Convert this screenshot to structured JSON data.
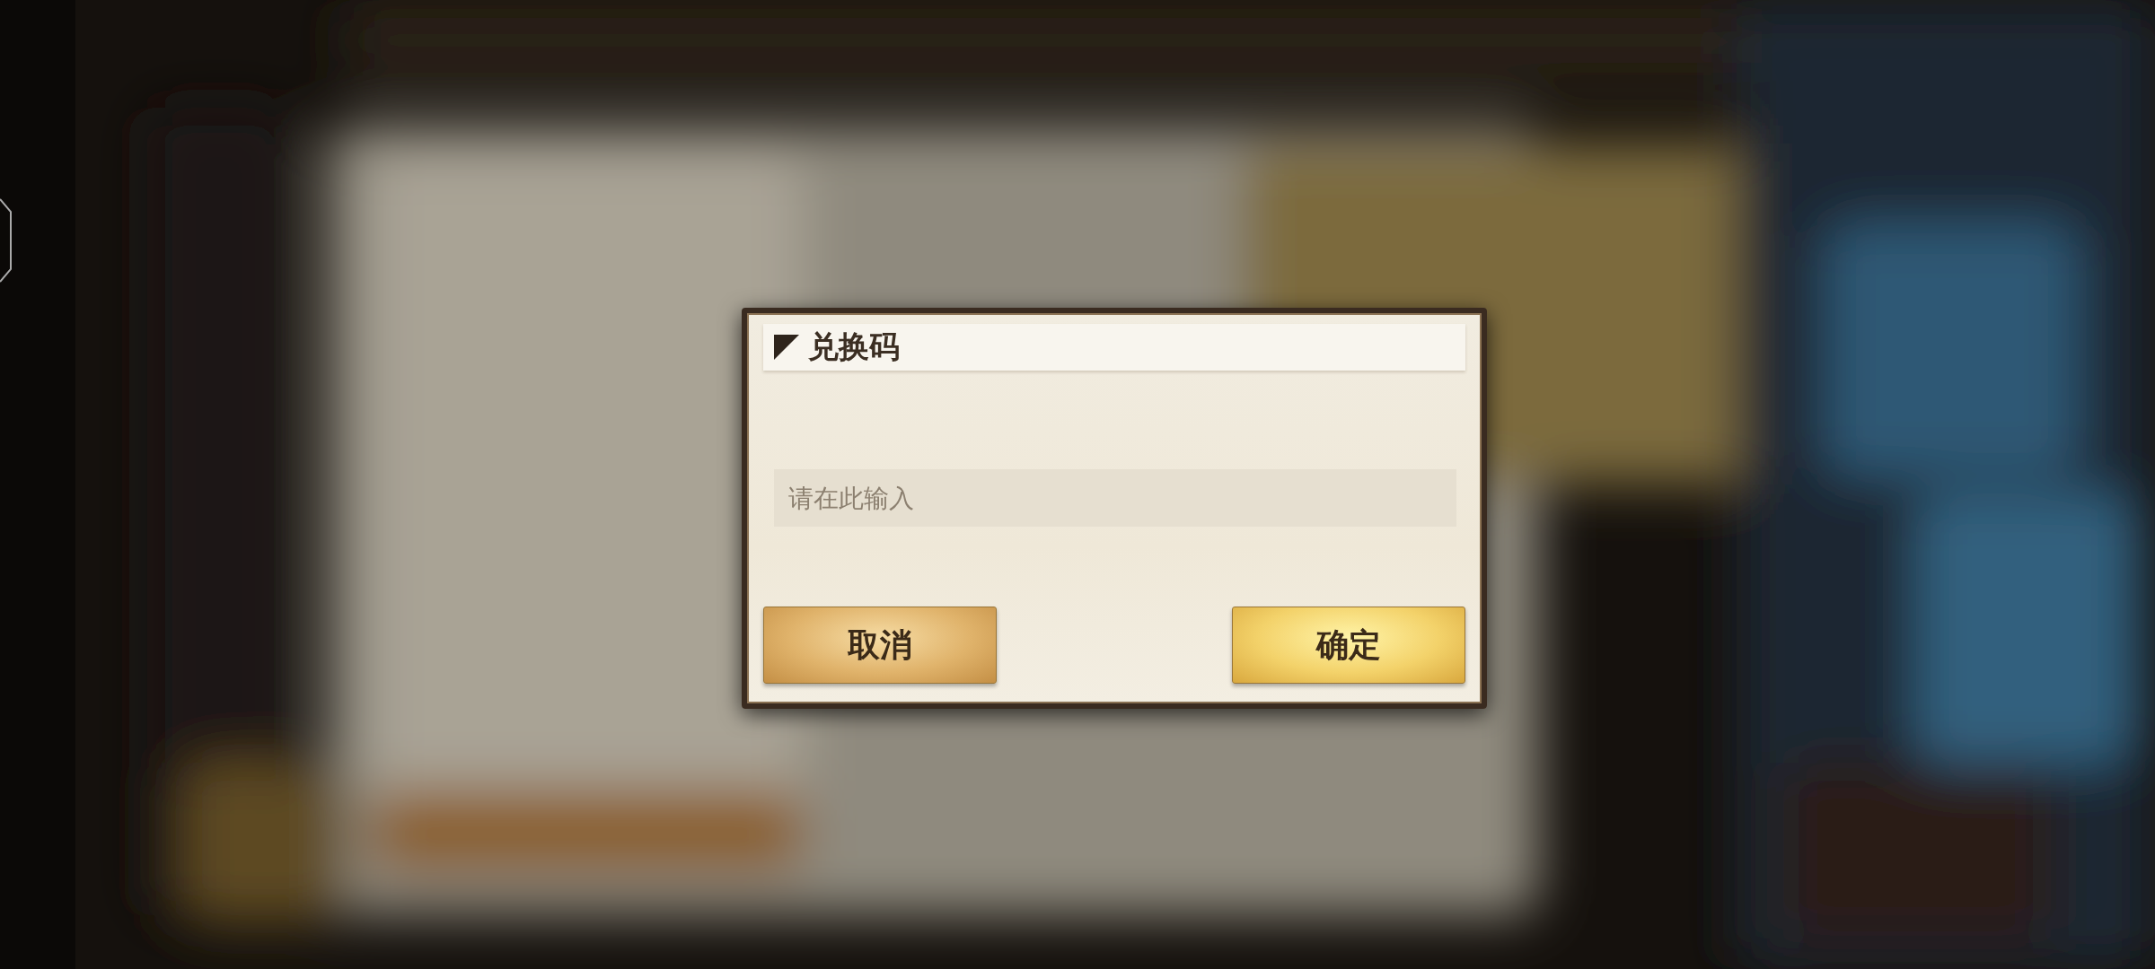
{
  "dialog": {
    "title": "兑换码",
    "input": {
      "placeholder": "请在此输入"
    },
    "buttons": [
      {
        "label": "取消",
        "kind": "cancel"
      },
      {
        "label": "确定",
        "kind": "confirm"
      }
    ]
  }
}
